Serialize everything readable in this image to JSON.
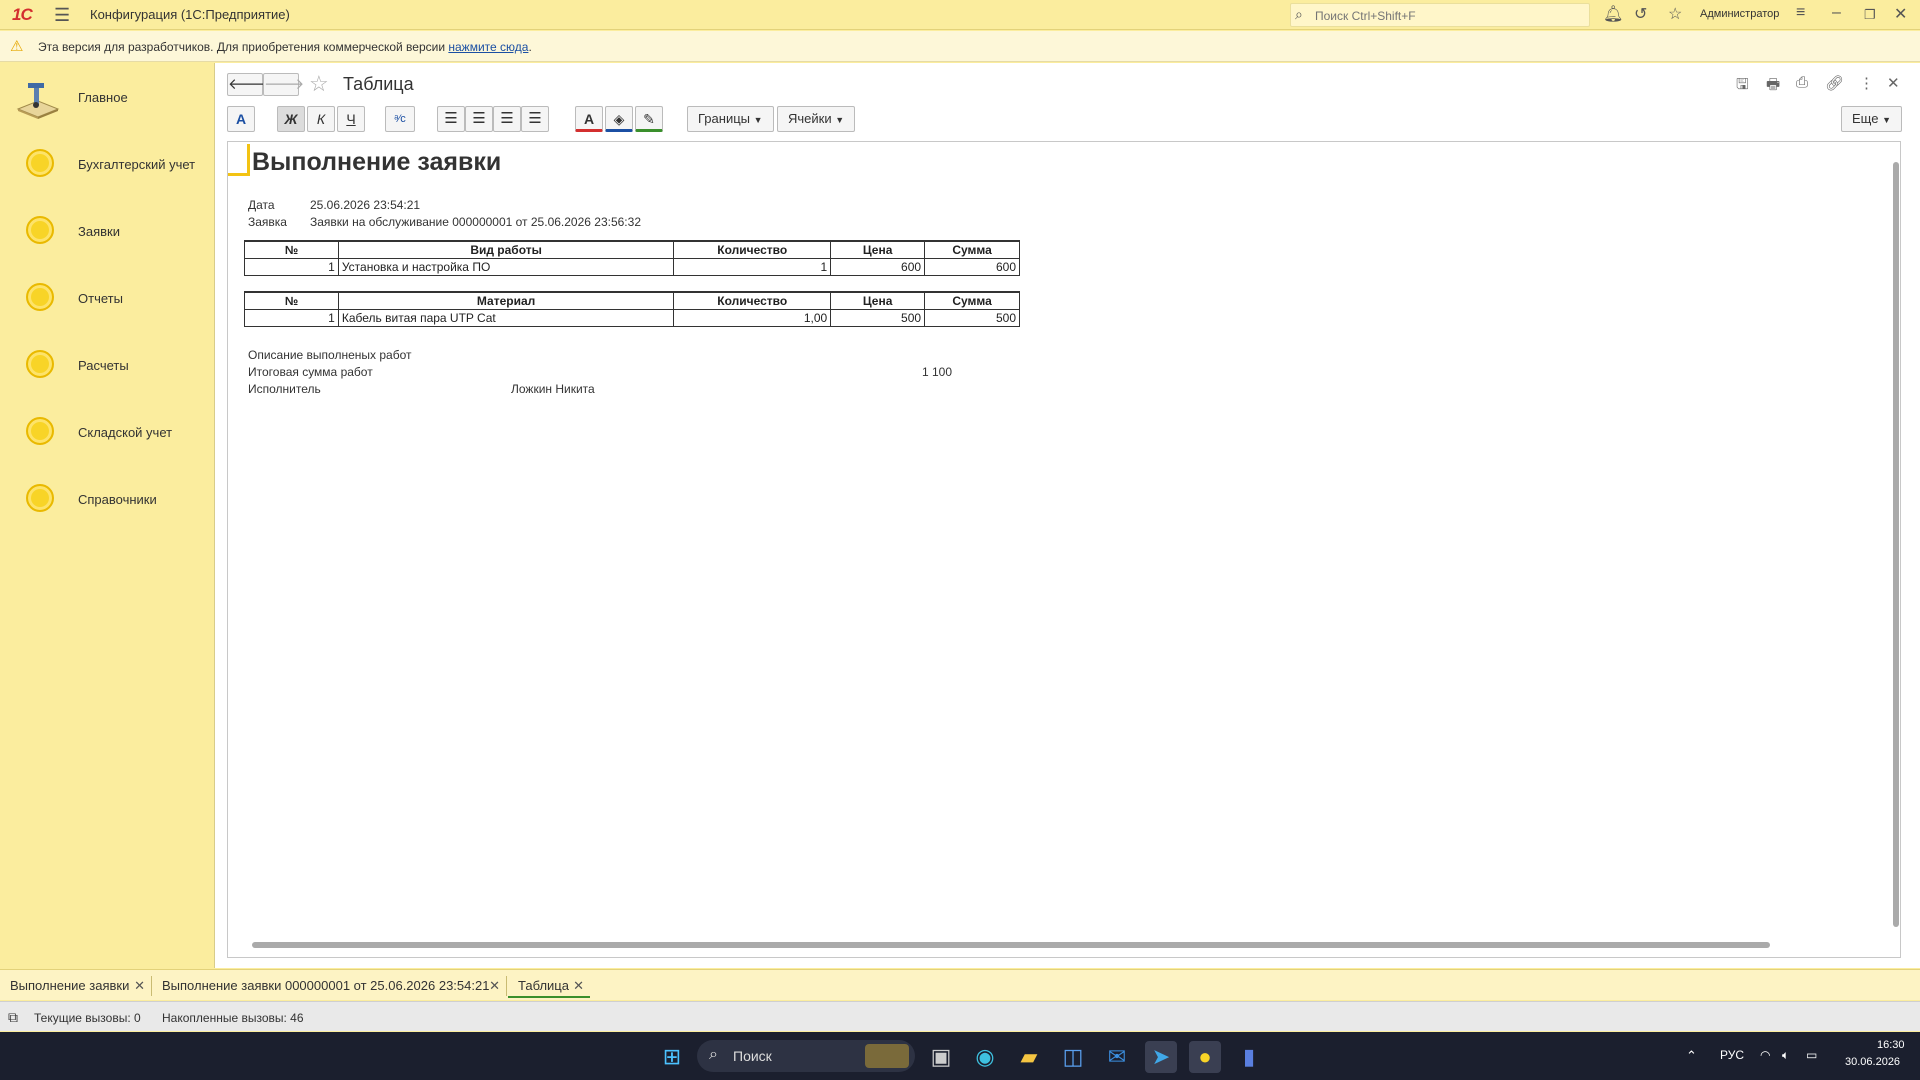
{
  "topbar": {
    "logo": "1С",
    "app_title": "Конфигурация  (1С:Предприятие)",
    "search_placeholder": "Поиск Ctrl+Shift+F",
    "user": "Администратор"
  },
  "warning": {
    "text": "Эта версия для разработчиков. Для приобретения коммерческой версии ",
    "link": "нажмите сюда",
    "suffix": "."
  },
  "sidebar": {
    "items": [
      {
        "label": "Главное",
        "icon": "home-icon"
      },
      {
        "label": "Бухгалтерский учет",
        "icon": "coin-icon"
      },
      {
        "label": "Заявки",
        "icon": "coin-icon"
      },
      {
        "label": "Отчеты",
        "icon": "coin-icon"
      },
      {
        "label": "Расчеты",
        "icon": "coin-icon"
      },
      {
        "label": "Складской учет",
        "icon": "coin-icon"
      },
      {
        "label": "Справочники",
        "icon": "coin-icon"
      }
    ]
  },
  "form": {
    "title": "Таблица",
    "toolbar": {
      "font": "A",
      "bold": "Ж",
      "italic": "К",
      "underline": "Ч",
      "borders": "Границы",
      "cells": "Ячейки",
      "more": "Еще"
    }
  },
  "document": {
    "title": "Выполнение заявки",
    "date_label": "Дата",
    "date_value": "25.06.2026 23:54:21",
    "request_label": "Заявка",
    "request_value": "Заявки на обслуживание 000000001 от 25.06.2026 23:56:32",
    "works_table": {
      "headers": [
        "№",
        "Вид работы",
        "Количество",
        "Цена",
        "Сумма"
      ],
      "rows": [
        [
          "1",
          "Установка и настройка ПО",
          "1",
          "600",
          "600"
        ]
      ]
    },
    "materials_table": {
      "headers": [
        "№",
        "Материал",
        "Количество",
        "Цена",
        "Сумма"
      ],
      "rows": [
        [
          "1",
          "Кабель витая пара UTP Cat",
          "1,00",
          "500",
          "500"
        ]
      ]
    },
    "description_label": "Описание выполненых работ",
    "total_label": "Итоговая сумма работ",
    "total_value": "1 100",
    "executor_label": "Исполнитель",
    "executor_value": "Ложкин Никита"
  },
  "tabs": [
    {
      "label": "Выполнение заявки",
      "active": false
    },
    {
      "label": "Выполнение заявки 000000001 от 25.06.2026 23:54:21",
      "active": false
    },
    {
      "label": "Таблица",
      "active": true
    }
  ],
  "status": {
    "current_calls": "Текущие вызовы: 0",
    "accumulated_calls": "Накопленные вызовы: 46"
  },
  "taskbar": {
    "search": "Поиск",
    "lang": "РУС",
    "time": "16:30",
    "date": "30.06.2026"
  },
  "colors": {
    "accent": "#fbed9e",
    "coin": "#f8d427",
    "active_tab": "#3a8f2c"
  }
}
